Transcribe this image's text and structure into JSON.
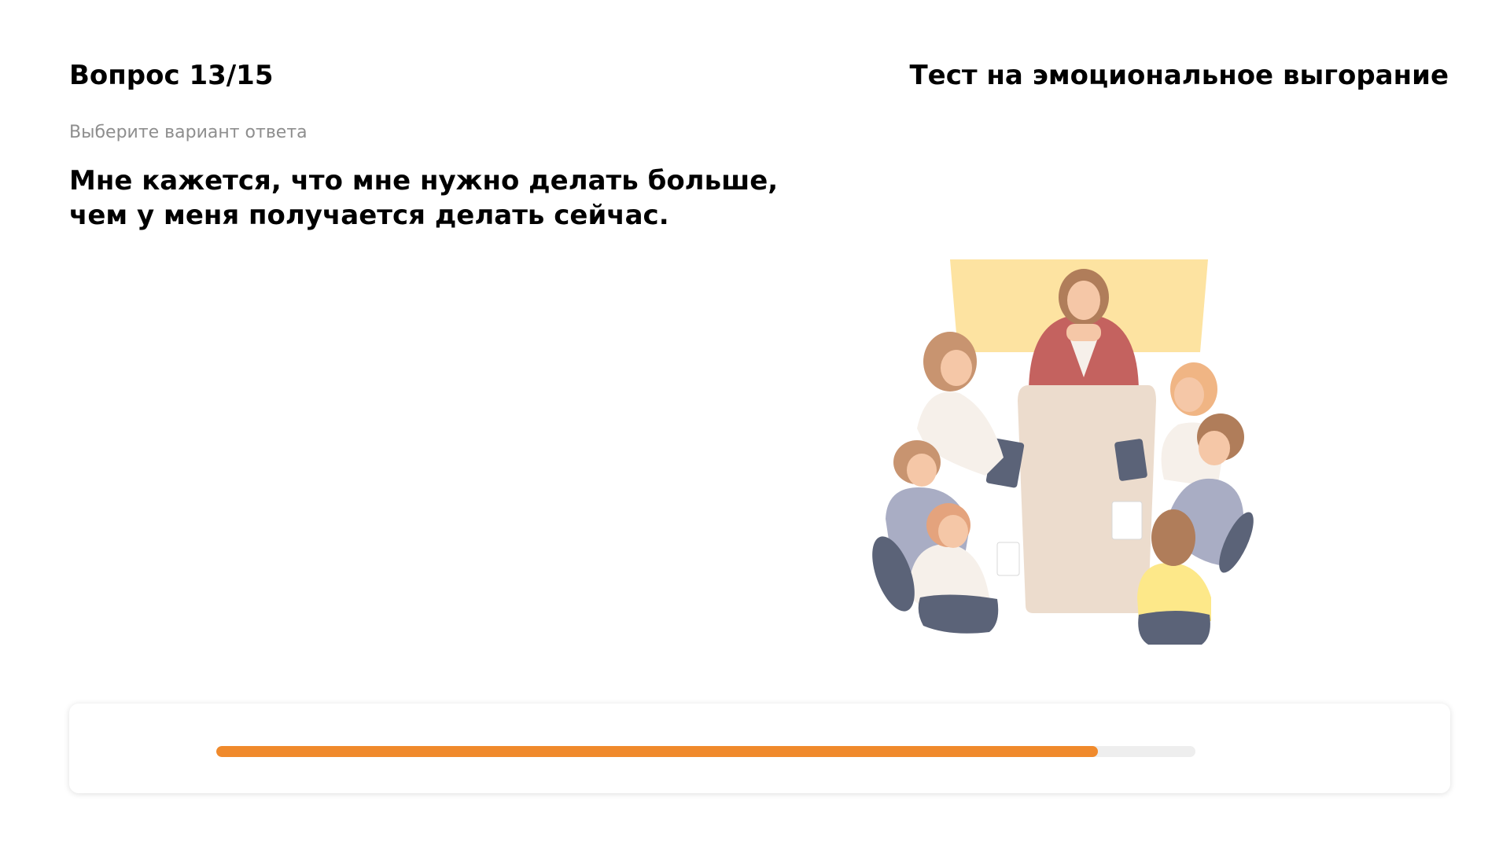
{
  "header": {
    "question_counter": "Вопрос 13/15",
    "test_title": "Тест на эмоциональное выгорание"
  },
  "question": {
    "instruction": "Выберите вариант ответа",
    "text_lines": [
      "Мне кажется, что мне нужно делать больше,",
      "чем у меня получается делать сейчас."
    ]
  },
  "illustration": {
    "icon": "team-meeting-illustration"
  },
  "progress": {
    "fraction": 0.9,
    "color": "#f08a2c",
    "track_color": "#eeeeee"
  }
}
